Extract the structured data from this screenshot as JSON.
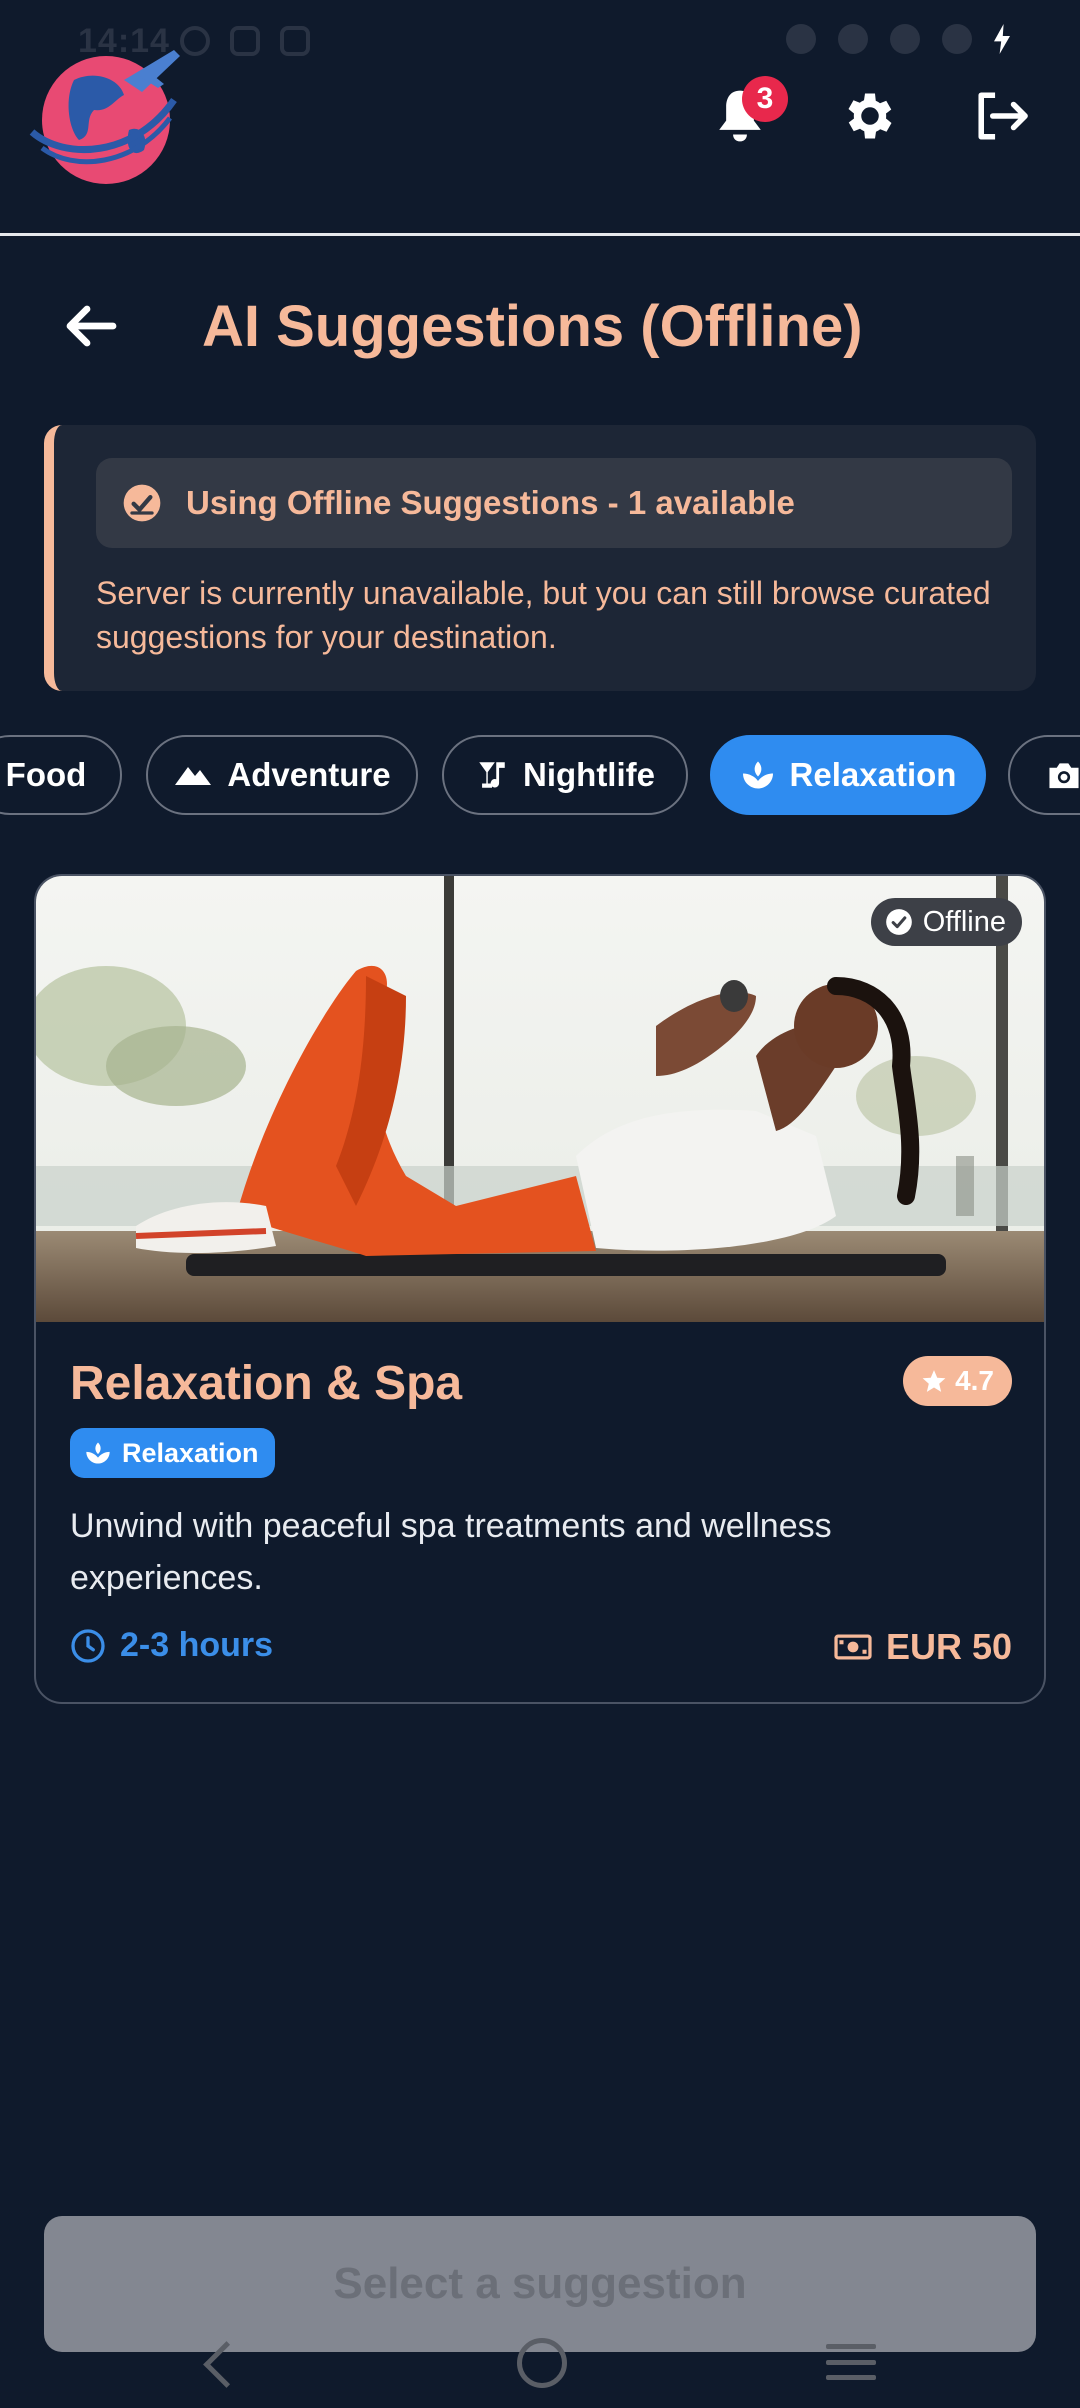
{
  "status_bar": {
    "time": "14:14"
  },
  "header": {
    "notification_count": "3"
  },
  "page": {
    "title": "AI Suggestions (Offline)"
  },
  "notice": {
    "heading": "Using Offline Suggestions - 1 available",
    "body": "Server is currently unavailable, but you can still browse curated suggestions for your destination."
  },
  "categories": [
    {
      "label": "Food",
      "icon": "food-icon",
      "selected": false
    },
    {
      "label": "Adventure",
      "icon": "mountain-icon",
      "selected": false
    },
    {
      "label": "Nightlife",
      "icon": "cocktail-icon",
      "selected": false
    },
    {
      "label": "Relaxation",
      "icon": "spa-icon",
      "selected": true
    },
    {
      "label": "",
      "icon": "camera-icon",
      "selected": false
    }
  ],
  "suggestion": {
    "offline_label": "Offline",
    "title": "Relaxation & Spa",
    "rating": "4.7",
    "category": "Relaxation",
    "description": "Unwind with peaceful spa treatments and wellness experiences.",
    "duration": "2-3 hours",
    "price": "EUR 50"
  },
  "footer": {
    "select_label": "Select a suggestion"
  },
  "colors": {
    "background": "#0f1a2c",
    "accent_peach": "#f6b99a",
    "accent_blue": "#2f8cf0",
    "badge_red": "#e8284c"
  }
}
